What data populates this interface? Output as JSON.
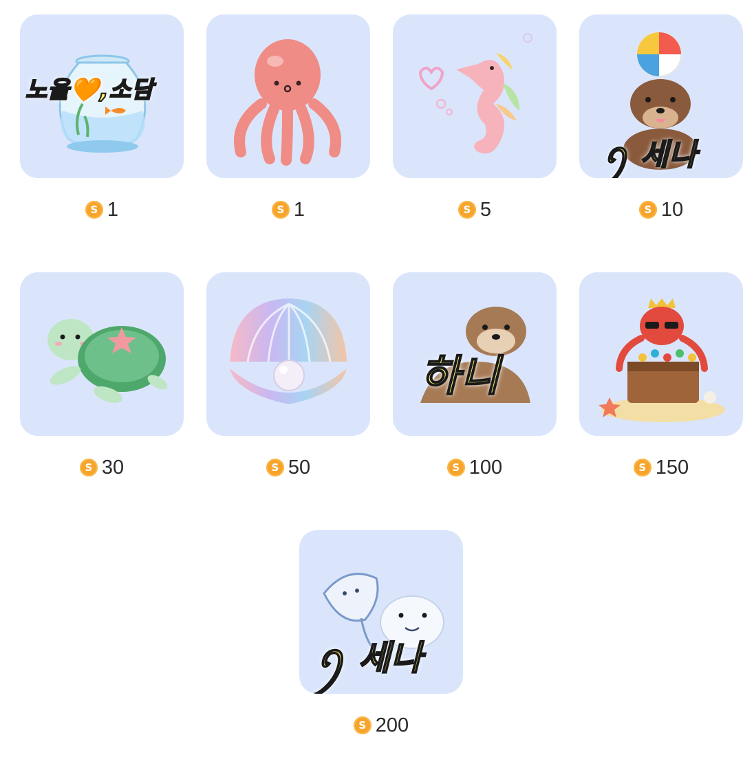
{
  "currency_icon": "coin-s-icon",
  "currency_symbol": "S",
  "colors": {
    "tile_bg": "#dae5fc",
    "coin": "#f7a42c",
    "overlay_text": "#fff36a"
  },
  "gifts": [
    {
      "icon": "fishbowl-icon",
      "price": "1",
      "overlay": "노을🧡,소담"
    },
    {
      "icon": "octopus-icon",
      "price": "1",
      "overlay": ""
    },
    {
      "icon": "seahorse-icon",
      "price": "5",
      "overlay": ""
    },
    {
      "icon": "sea-lion-beach-ball-icon",
      "price": "10",
      "overlay": "ꪆ 세나"
    },
    {
      "icon": "sea-turtle-icon",
      "price": "30",
      "overlay": ""
    },
    {
      "icon": "pearl-shell-icon",
      "price": "50",
      "overlay": ""
    },
    {
      "icon": "otter-icon",
      "price": "100",
      "overlay": "하니"
    },
    {
      "icon": "octopus-treasure-chest-icon",
      "price": "150",
      "overlay": ""
    },
    {
      "icon": "stingray-beluga-icon",
      "price": "200",
      "overlay": "ꪆ 세나"
    }
  ]
}
